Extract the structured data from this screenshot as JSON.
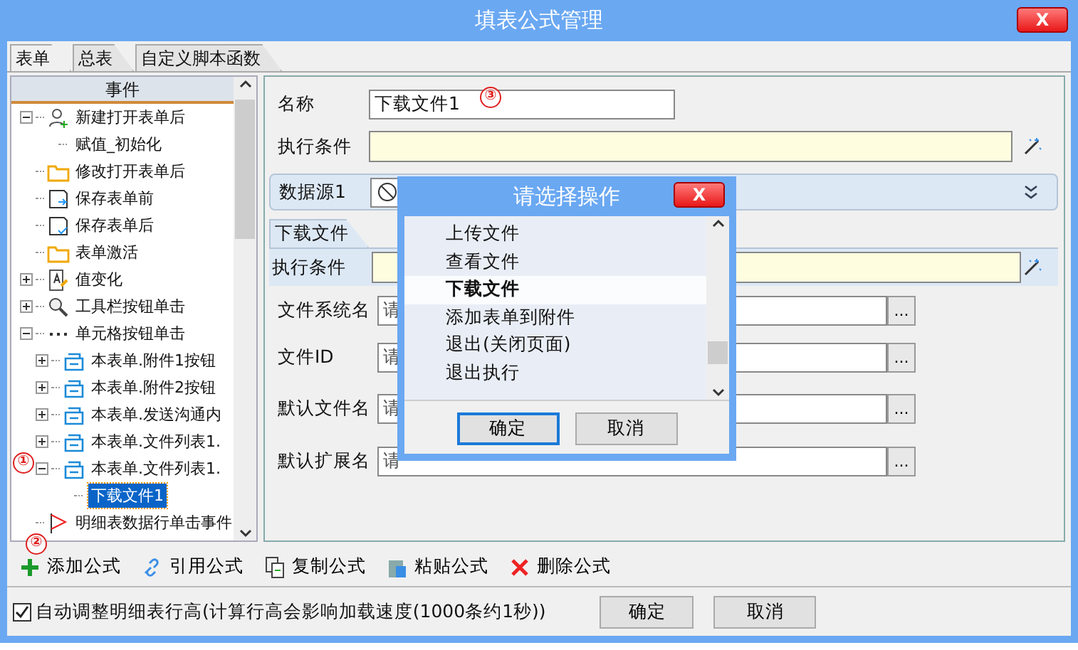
{
  "window": {
    "title": "填表公式管理",
    "close": "X"
  },
  "tabs": [
    {
      "label": "表单",
      "selected": true
    },
    {
      "label": "总表",
      "selected": false
    },
    {
      "label": "自定义脚本函数",
      "selected": false
    }
  ],
  "tree": {
    "header": "事件",
    "items": [
      {
        "label": "新建打开表单后",
        "kind": "user",
        "expanded": true,
        "selected": false,
        "children": [
          {
            "label": "赋值_初始化",
            "kind": "none",
            "selected": false
          }
        ]
      },
      {
        "label": "修改打开表单后",
        "kind": "folder",
        "selected": false
      },
      {
        "label": "保存表单前",
        "kind": "save-in",
        "selected": false
      },
      {
        "label": "保存表单后",
        "kind": "save-check",
        "selected": false
      },
      {
        "label": "表单激活",
        "kind": "folder",
        "selected": false
      },
      {
        "label": "值变化",
        "kind": "edit",
        "expanded": false,
        "selected": false
      },
      {
        "label": "工具栏按钮单击",
        "kind": "search",
        "expanded": false,
        "selected": false
      },
      {
        "label": "单元格按钮单击",
        "kind": "dots",
        "expanded": true,
        "selected": false,
        "children": [
          {
            "label": "本表单.附件1按钮",
            "kind": "tray",
            "expanded": false,
            "selected": false
          },
          {
            "label": "本表单.附件2按钮",
            "kind": "tray",
            "expanded": false,
            "selected": false
          },
          {
            "label": "本表单.发送沟通内",
            "kind": "tray",
            "expanded": false,
            "selected": false
          },
          {
            "label": "本表单.文件列表1.",
            "kind": "tray",
            "expanded": false,
            "selected": false
          },
          {
            "label": "本表单.文件列表1.",
            "kind": "tray",
            "expanded": true,
            "selected": false,
            "children": [
              {
                "label": "下载文件1",
                "kind": "none",
                "selected": true
              }
            ]
          }
        ]
      },
      {
        "label": "明细表数据行单击事件",
        "kind": "flag",
        "selected": false
      }
    ]
  },
  "form": {
    "name_label": "名称",
    "name_value": "下载文件1",
    "condition_label": "执行条件",
    "datasource_label": "数据源1",
    "subtab": "下载文件",
    "sub_condition_label": "执行条件",
    "fields": [
      {
        "label": "文件系统名",
        "placeholder": "请",
        "button": "..."
      },
      {
        "label": "文件ID",
        "placeholder": "请",
        "button": "..."
      },
      {
        "label": "默认文件名",
        "placeholder": "请",
        "button": "..."
      },
      {
        "label": "默认扩展名",
        "placeholder": "请",
        "button": "..."
      }
    ]
  },
  "toolbar": [
    {
      "label": "添加公式",
      "kind": "add"
    },
    {
      "label": "引用公式",
      "kind": "link"
    },
    {
      "label": "复制公式",
      "kind": "copy"
    },
    {
      "label": "粘贴公式",
      "kind": "paste"
    },
    {
      "label": "删除公式",
      "kind": "delete"
    }
  ],
  "auto_height": {
    "label": "自动调整明细表行高(计算行高会影响加载速度(1000条约1秒))",
    "checked": true
  },
  "buttons": [
    "确定",
    "取消"
  ],
  "dialog": {
    "title": "请选择操作",
    "close": "X",
    "options": [
      {
        "label": "上传文件",
        "selected": false
      },
      {
        "label": "查看文件",
        "selected": false
      },
      {
        "label": "下载文件",
        "selected": true
      },
      {
        "label": "添加表单到附件",
        "selected": false
      },
      {
        "label": "退出(关闭页面)",
        "selected": false
      },
      {
        "label": "退出执行",
        "selected": false
      }
    ],
    "buttons": [
      "确定",
      "取消"
    ]
  },
  "markers": [
    {
      "label": "①"
    },
    {
      "label": "②"
    },
    {
      "label": "③"
    }
  ]
}
